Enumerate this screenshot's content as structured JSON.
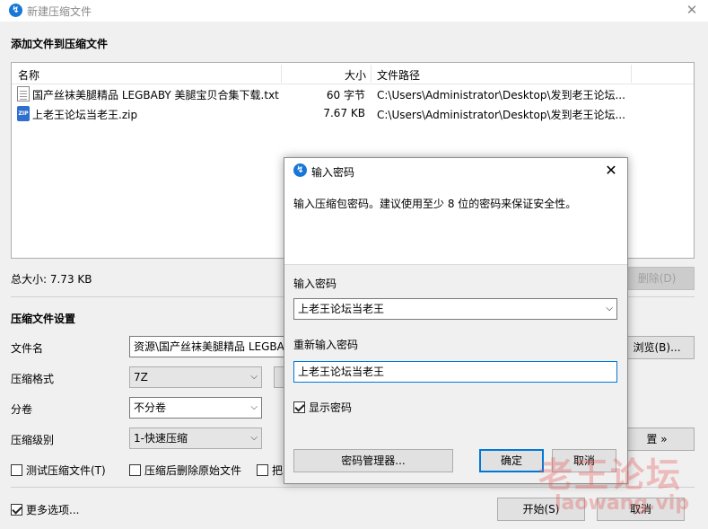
{
  "window": {
    "title": "新建压缩文件",
    "close_glyph": "✕"
  },
  "files_section": {
    "title": "添加文件到压缩文件"
  },
  "file_list": {
    "columns": {
      "name": "名称",
      "size": "大小",
      "path": "文件路径"
    },
    "rows": [
      {
        "name": "国产丝袜美腿精品 LEGBABY 美腿宝贝合集下载.txt",
        "size": "60 字节",
        "path": "C:\\Users\\Administrator\\Desktop\\发到老王论坛...",
        "icon": "text-file-icon"
      },
      {
        "name": "上老王论坛当老王.zip",
        "size": "7.67 KB",
        "path": "C:\\Users\\Administrator\\Desktop\\发到老王论坛...",
        "icon": "zip-file-icon"
      }
    ]
  },
  "total_size": "总大小: 7.73 KB",
  "delete_button": "删除(D)",
  "settings": {
    "title": "压缩文件设置",
    "filename_label": "文件名",
    "filename_value": "资源\\国产丝袜美腿精品 LEGBA",
    "browse_button": "浏览(B)...",
    "format_label": "压缩格式",
    "format_value": "7Z",
    "split_label": "分卷",
    "split_value": "不分卷",
    "level_label": "压缩级别",
    "level_value": "1-快速压缩",
    "advanced_button": "置 »",
    "test_checkbox": "测试压缩文件(T)",
    "delete_after_checkbox": "压缩后删除原始文件",
    "third_checkbox": "把",
    "more_options_checkbox": "更多选项..."
  },
  "footer": {
    "start_button": "开始(S)",
    "cancel_button": "取消"
  },
  "dialog": {
    "title": "输入密码",
    "description": "输入压缩包密码。建议使用至少 8 位的密码来保证安全性。",
    "password_label": "输入密码",
    "password_value": "上老王论坛当老王",
    "confirm_label": "重新输入密码",
    "confirm_value": "上老王论坛当老王",
    "show_password": "显示密码",
    "manager_button": "密码管理器...",
    "ok_button": "确定",
    "cancel_button": "取消",
    "close_glyph": "✕"
  },
  "watermark": {
    "line1": "老王论坛",
    "line2": "laowang.vip"
  },
  "colors": {
    "accent": "#0078d7",
    "app_icon": "#1877d6",
    "window_bg": "#f0f0f0"
  }
}
